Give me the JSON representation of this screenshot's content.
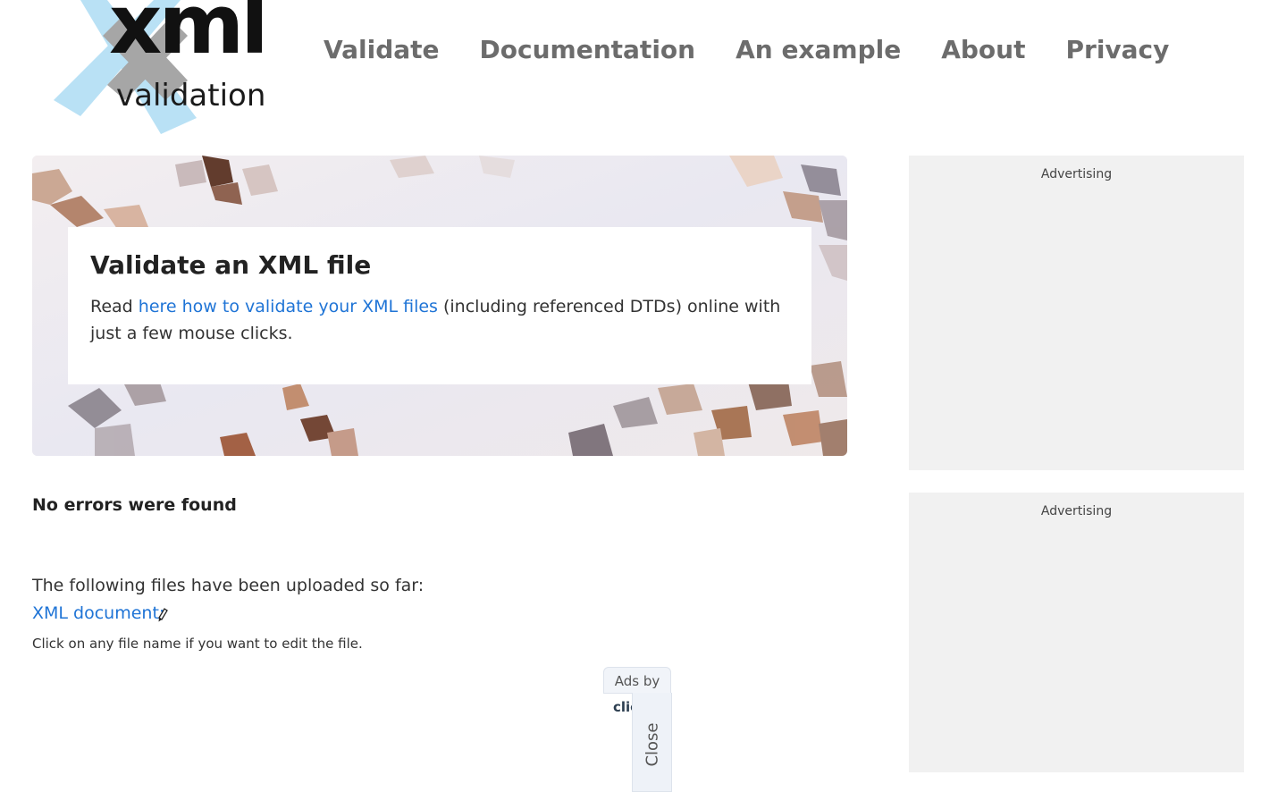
{
  "header": {
    "logo_main": "xml",
    "logo_sub": "validation",
    "nav": [
      {
        "label": "Validate"
      },
      {
        "label": "Documentation"
      },
      {
        "label": "An example"
      },
      {
        "label": "About"
      },
      {
        "label": "Privacy"
      }
    ]
  },
  "hero": {
    "title": "Validate an XML file",
    "text_before": "Read ",
    "link_text": "here how to validate your XML files",
    "text_after": " (including referenced DTDs) online with just a few mouse clicks."
  },
  "results": {
    "status": "No errors were found",
    "uploaded_intro": "The following files have been uploaded so far:",
    "file_link": "XML document:",
    "edit_hint": "Click on any file name if you want to edit the file.",
    "pencil_icon": "pencil-icon"
  },
  "ads": {
    "sidebar_label_1": "Advertising",
    "sidebar_label_2": "Advertising",
    "ads_by": "Ads by",
    "brand": "clickio",
    "close": "Close"
  },
  "colors": {
    "link": "#1f74d6",
    "nav": "#6c6c6c",
    "logo_cross_light": "#b9e1f5",
    "logo_cross_dark": "#a6a6a6"
  }
}
